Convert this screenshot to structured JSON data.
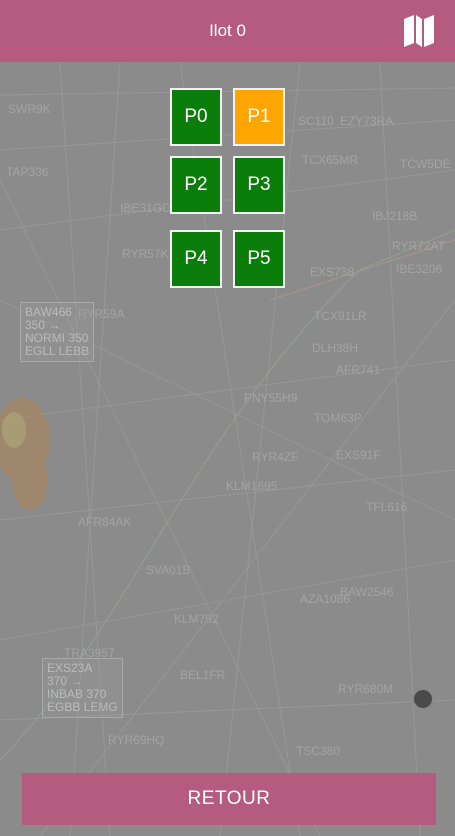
{
  "header": {
    "title": "Ilot 0",
    "map_icon": "folded-map-icon",
    "background": "#b55b80"
  },
  "positions": [
    {
      "label": "P0",
      "color": "#0b7d0b"
    },
    {
      "label": "P1",
      "color": "#ffa500"
    },
    {
      "label": "P2",
      "color": "#0b7d0b"
    },
    {
      "label": "P3",
      "color": "#0b7d0b"
    },
    {
      "label": "P4",
      "color": "#0b7d0b"
    },
    {
      "label": "P5",
      "color": "#0b7d0b"
    }
  ],
  "footer": {
    "back_label": "RETOUR"
  },
  "map": {
    "callsigns": [
      "SWR9K",
      "TAP336",
      "IBE31GC",
      "RYR57K",
      "RYR59A",
      "AFR84AK",
      "SVA01B",
      "KLM792",
      "BEL1FR",
      "RYR69HQ",
      "TSC380",
      "RYR680M",
      "KLM1695",
      "RYR4ZF",
      "TOM63P",
      "EXS91F",
      "TFL616",
      "PNY55H9",
      "DLH38H",
      "AFR741",
      "TCX91LR",
      "EXS738",
      "IBE3206",
      "RYR72AT",
      "IBJ218B",
      "TCW5DE",
      "TCX65MR",
      "EZY73RA",
      "SC110",
      "BAW2546",
      "AZA1086",
      "TRA3957"
    ],
    "tags": [
      {
        "lines": [
          "BAW466",
          "350 →",
          "NORMI  350",
          "EGLL  LEBB"
        ]
      },
      {
        "lines": [
          "EXS23A",
          "370 →",
          "INBAB  370",
          "EGBB  LEMG"
        ]
      }
    ]
  }
}
